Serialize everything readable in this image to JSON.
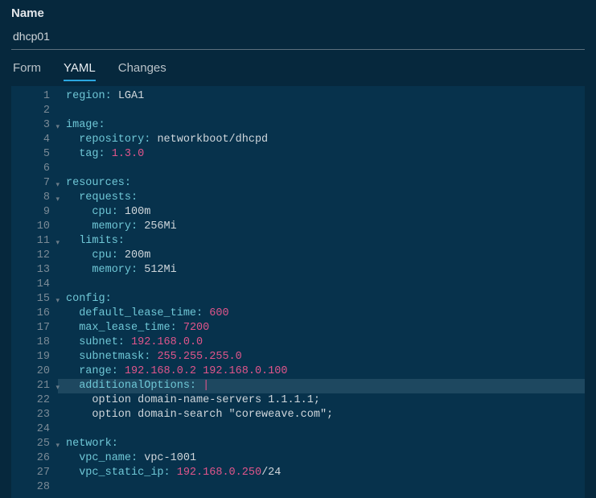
{
  "header": {
    "name_label": "Name",
    "name_value": "dhcp01"
  },
  "tabs": {
    "form": "Form",
    "yaml": "YAML",
    "changes": "Changes",
    "active": "yaml"
  },
  "yaml": {
    "region_key": "region:",
    "region_val": "LGA1",
    "image_key": "image:",
    "repository_key": "repository:",
    "repository_val": "networkboot/dhcpd",
    "tag_key": "tag:",
    "tag_val": "1.3.0",
    "resources_key": "resources:",
    "requests_key": "requests:",
    "cpu_key": "cpu:",
    "cpu_req": "100m",
    "memory_key": "memory:",
    "memory_req": "256Mi",
    "limits_key": "limits:",
    "cpu_lim": "200m",
    "memory_lim": "512Mi",
    "config_key": "config:",
    "default_lease_key": "default_lease_time:",
    "default_lease_val": "600",
    "max_lease_key": "max_lease_time:",
    "max_lease_val": "7200",
    "subnet_key": "subnet:",
    "subnet_val": "192.168.0.0",
    "subnetmask_key": "subnetmask:",
    "subnetmask_val": "255.255.255.0",
    "range_key": "range:",
    "range_val": "192.168.0.2 192.168.0.100",
    "addopts_key": "additionalOptions:",
    "addopts_pipe": "|",
    "opt1_a": "option domain-name-servers ",
    "opt1_b": "1.1.1.1;",
    "opt2": "option domain-search \"coreweave.com\";",
    "network_key": "network:",
    "vpc_name_key": "vpc_name:",
    "vpc_name_val": "vpc-1001",
    "vpc_ip_key": "vpc_static_ip:",
    "vpc_ip_val": "192.168.0.250",
    "vpc_ip_suffix": "/24"
  },
  "lines": [
    "1",
    "2",
    "3",
    "4",
    "5",
    "6",
    "7",
    "8",
    "9",
    "10",
    "11",
    "12",
    "13",
    "14",
    "15",
    "16",
    "17",
    "18",
    "19",
    "20",
    "21",
    "22",
    "23",
    "24",
    "25",
    "26",
    "27",
    "28"
  ]
}
